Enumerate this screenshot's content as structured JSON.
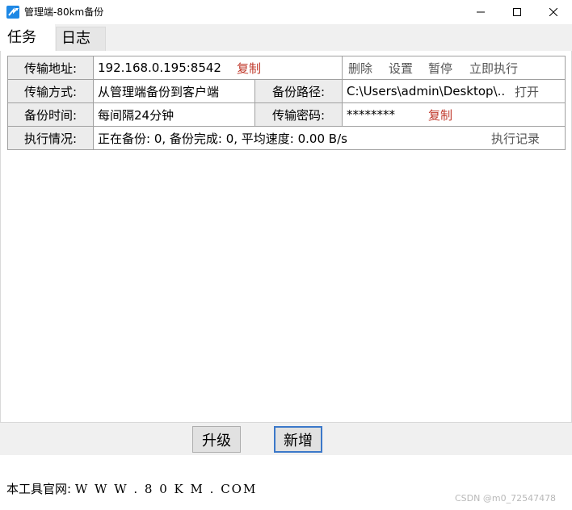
{
  "window": {
    "title": "管理端-80km备份",
    "icon": "app-arrow-icon",
    "controls": [
      "minimize-icon",
      "maximize-icon",
      "close-icon"
    ]
  },
  "tabs": [
    {
      "label": "任务",
      "active": true
    },
    {
      "label": "日志",
      "active": false
    }
  ],
  "task": {
    "row1": {
      "address_label": "传输地址:",
      "address_value": "192.168.0.195:8542",
      "copy_label": "复制",
      "actions": [
        "删除",
        "设置",
        "暂停",
        "立即执行"
      ]
    },
    "row2": {
      "mode_label": "传输方式:",
      "mode_value": "从管理端备份到客户端",
      "path_label": "备份路径:",
      "path_value": "C:\\Users\\admin\\Desktop\\...",
      "open_label": "打开"
    },
    "row3": {
      "time_label": "备份时间:",
      "time_value": "每间隔24分钟",
      "password_label": "传输密码:",
      "password_value": "********",
      "copy_label": "复制"
    },
    "row4": {
      "status_label": "执行情况:",
      "status_value": "正在备份: 0, 备份完成: 0, 平均速度: 0.00 B/s",
      "history_label": "执行记录"
    }
  },
  "buttons": {
    "upgrade_label": "升级",
    "add_label": "新增"
  },
  "footer": {
    "site_label": "本工具官网:",
    "site_url": "W W W . 8 0 K M . COM"
  },
  "watermark": "CSDN @m0_72547478",
  "colors": {
    "link_red": "#c0392b",
    "accent_blue": "#3b78c9",
    "icon_blue": "#1e88e5"
  }
}
